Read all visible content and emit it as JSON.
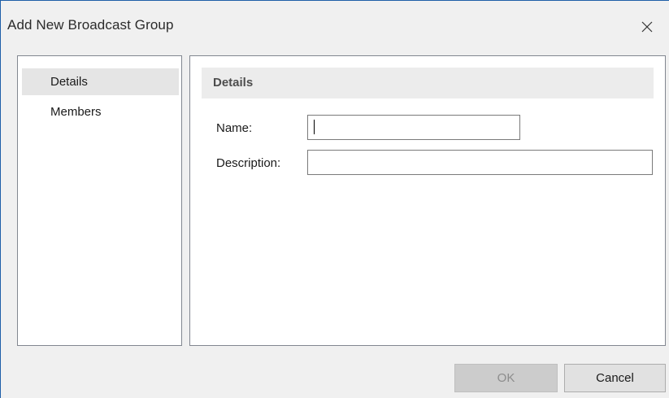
{
  "window": {
    "title": "Add New Broadcast Group",
    "close_icon": "close-icon"
  },
  "nav": {
    "items": [
      {
        "label": "Details",
        "selected": true
      },
      {
        "label": "Members",
        "selected": false
      }
    ]
  },
  "details": {
    "section_title": "Details",
    "name_label": "Name:",
    "name_value": "",
    "description_label": "Description:",
    "description_value": ""
  },
  "footer": {
    "ok_label": "OK",
    "ok_enabled": false,
    "cancel_label": "Cancel"
  },
  "colors": {
    "window_border": "#1f5fa8",
    "selected_nav_bg": "#e5e5e5",
    "section_header_bg": "#ececec",
    "disabled_button_bg": "#cccccc"
  }
}
